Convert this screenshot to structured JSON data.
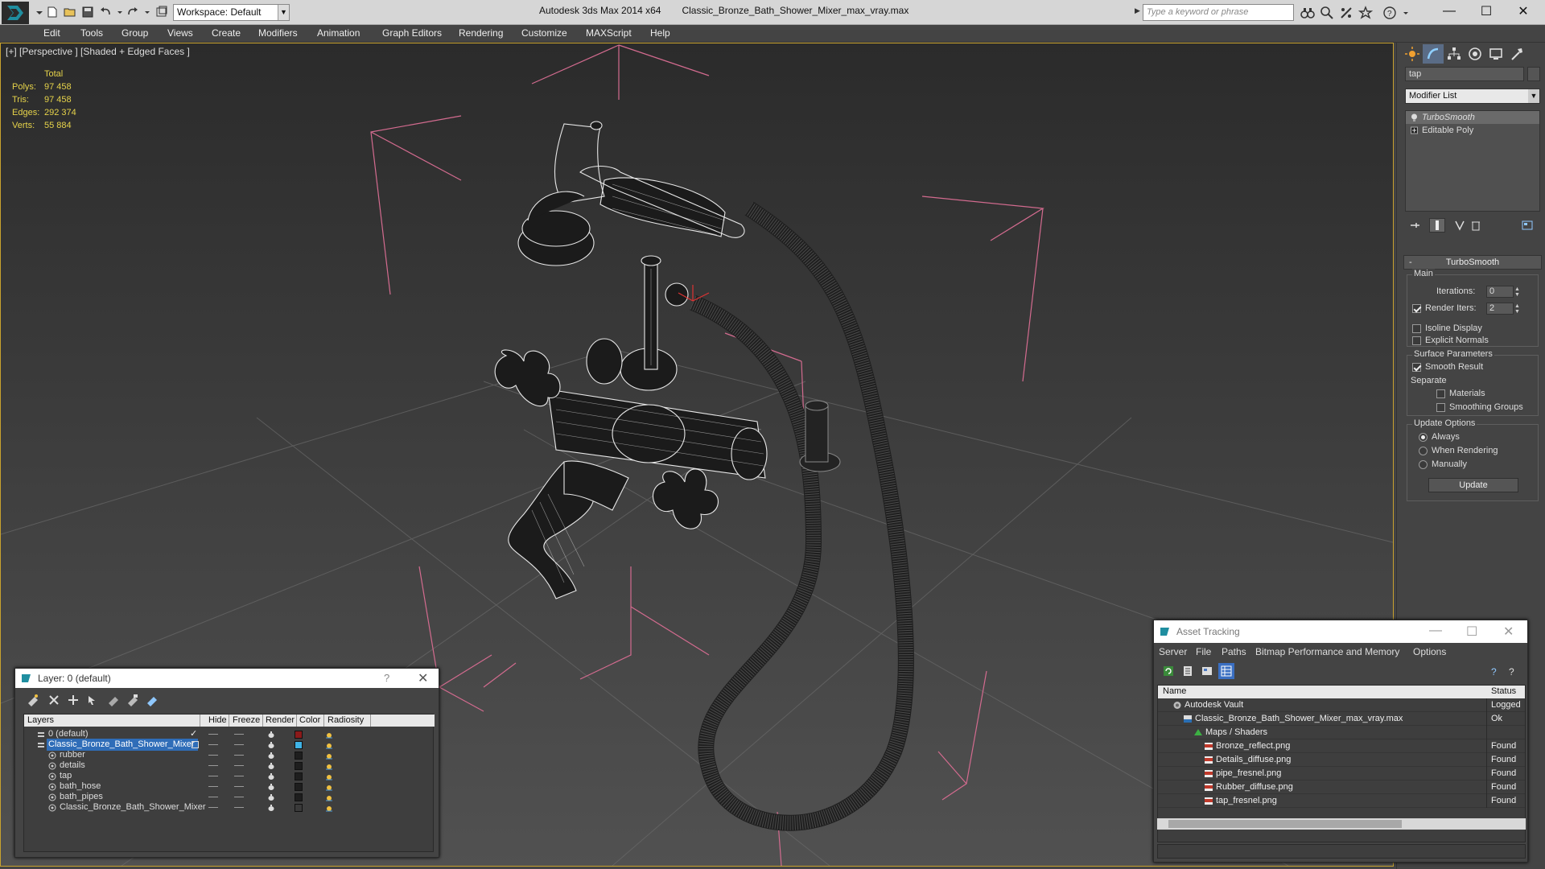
{
  "window": {
    "app_title": "Autodesk 3ds Max  2014 x64",
    "file_title": "Classic_Bronze_Bath_Shower_Mixer_max_vray.max",
    "workspace": "Workspace: Default",
    "search_placeholder": "Type a keyword or phrase"
  },
  "menu": [
    "Edit",
    "Tools",
    "Group",
    "Views",
    "Create",
    "Modifiers",
    "Animation",
    "Graph Editors",
    "Rendering",
    "Customize",
    "MAXScript",
    "Help"
  ],
  "viewport": {
    "label": "[+] [Perspective ] [Shaded + Edged Faces ]",
    "stats_header": "Total",
    "stats": [
      {
        "label": "Polys:",
        "value": "97 458"
      },
      {
        "label": "Tris:",
        "value": "97 458"
      },
      {
        "label": "Edges:",
        "value": "292 374"
      },
      {
        "label": "Verts:",
        "value": "55 884"
      }
    ]
  },
  "command_panel": {
    "object_name": "tap",
    "modifier_list": "Modifier List",
    "stack": [
      {
        "label": "TurboSmooth",
        "selected": true
      },
      {
        "label": "Editable Poly",
        "selected": false
      }
    ],
    "rollout_title": "TurboSmooth",
    "main_group": "Main",
    "iterations_label": "Iterations:",
    "iterations_value": "0",
    "render_iters_label": "Render Iters:",
    "render_iters_value": "2",
    "isoline_label": "Isoline Display",
    "explicit_normals_label": "Explicit Normals",
    "surface_group": "Surface Parameters",
    "smooth_result_label": "Smooth Result",
    "separate_label": "Separate",
    "materials_label": "Materials",
    "smoothing_groups_label": "Smoothing Groups",
    "update_group": "Update Options",
    "always_label": "Always",
    "when_rendering_label": "When Rendering",
    "manually_label": "Manually",
    "update_button": "Update"
  },
  "layer_dialog": {
    "title": "Layer: 0 (default)",
    "help": "?",
    "columns": [
      "Layers",
      "Hide",
      "Freeze",
      "Render",
      "Color",
      "Radiosity"
    ],
    "rows": [
      {
        "name": "0 (default)",
        "indent": 0,
        "color": "#8b1a1a",
        "selected": false
      },
      {
        "name": "Classic_Bronze_Bath_Shower_Mixer",
        "indent": 0,
        "color": "#3fb3e6",
        "selected": true
      },
      {
        "name": "rubber",
        "indent": 1,
        "color": "#1e1e1e",
        "selected": false
      },
      {
        "name": "details",
        "indent": 1,
        "color": "#1e1e1e",
        "selected": false
      },
      {
        "name": "tap",
        "indent": 1,
        "color": "#1e1e1e",
        "selected": false
      },
      {
        "name": "bath_hose",
        "indent": 1,
        "color": "#1e1e1e",
        "selected": false
      },
      {
        "name": "bath_pipes",
        "indent": 1,
        "color": "#1e1e1e",
        "selected": false
      },
      {
        "name": "Classic_Bronze_Bath_Shower_Mixer",
        "indent": 1,
        "color": "#3a3a3a",
        "selected": false
      }
    ]
  },
  "asset_dialog": {
    "title": "Asset Tracking",
    "menu": [
      "Server",
      "File",
      "Paths",
      "Bitmap Performance and Memory",
      "Options"
    ],
    "columns": [
      "Name",
      "Status"
    ],
    "rows": [
      {
        "name": "Autodesk Vault",
        "status": "Logged",
        "indent": 0,
        "icon": "vault"
      },
      {
        "name": "Classic_Bronze_Bath_Shower_Mixer_max_vray.max",
        "status": "Ok",
        "indent": 1,
        "icon": "max"
      },
      {
        "name": "Maps / Shaders",
        "status": "",
        "indent": 2,
        "icon": "maps"
      },
      {
        "name": "Bronze_reflect.png",
        "status": "Found",
        "indent": 3,
        "icon": "png"
      },
      {
        "name": "Details_diffuse.png",
        "status": "Found",
        "indent": 3,
        "icon": "png"
      },
      {
        "name": "pipe_fresnel.png",
        "status": "Found",
        "indent": 3,
        "icon": "png"
      },
      {
        "name": "Rubber_diffuse.png",
        "status": "Found",
        "indent": 3,
        "icon": "png"
      },
      {
        "name": "tap_fresnel.png",
        "status": "Found",
        "indent": 3,
        "icon": "png"
      }
    ]
  }
}
